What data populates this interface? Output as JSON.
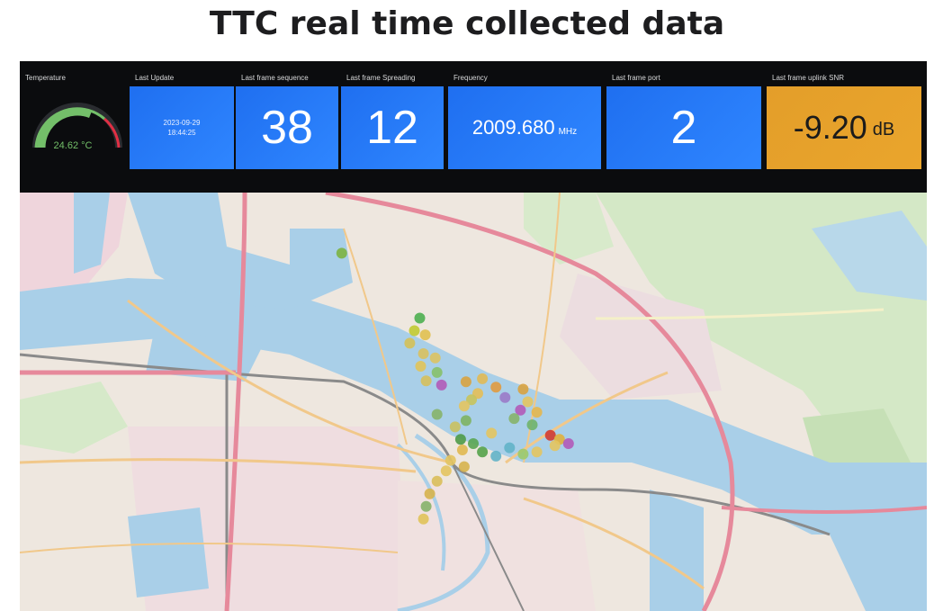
{
  "page": {
    "title": "TTC real time collected data"
  },
  "panels": {
    "temperature": {
      "title": "Temperature",
      "value": "24.62 °C",
      "level": 0.62
    },
    "last_update": {
      "title": "Last Update",
      "date": "2023-09-29",
      "time": "18:44:25"
    },
    "frame_sequence": {
      "title": "Last frame sequence",
      "value": "38"
    },
    "frame_spreading": {
      "title": "Last frame Spreading",
      "value": "12"
    },
    "frequency": {
      "title": "Frequency",
      "value": "2009.680",
      "unit": "MHz"
    },
    "frame_port": {
      "title": "Last frame port",
      "value": "2"
    },
    "uplink_snr": {
      "title": "Last frame uplink SNR",
      "value": "-9.20",
      "unit": "dB"
    }
  },
  "colors": {
    "stat_blue": "#2f80f5",
    "stat_orange": "#e8a22b",
    "gauge_green": "#73bf69",
    "gauge_red": "#e02f44",
    "water": "#a9cfe8",
    "motorway": "#e6899b",
    "rail": "#8a8a8a",
    "park": "#cfe6c4"
  },
  "map": {
    "points": [
      {
        "lat": 0.145,
        "lng": 0.355,
        "color": "#7cb342"
      },
      {
        "lat": 0.3,
        "lng": 0.441,
        "color": "#4caf50"
      },
      {
        "lat": 0.33,
        "lng": 0.435,
        "color": "#c0ca33"
      },
      {
        "lat": 0.34,
        "lng": 0.447,
        "color": "#e0c050"
      },
      {
        "lat": 0.36,
        "lng": 0.43,
        "color": "#d4c058"
      },
      {
        "lat": 0.385,
        "lng": 0.445,
        "color": "#d8c060"
      },
      {
        "lat": 0.395,
        "lng": 0.458,
        "color": "#dcc262"
      },
      {
        "lat": 0.415,
        "lng": 0.442,
        "color": "#e0c35a"
      },
      {
        "lat": 0.43,
        "lng": 0.46,
        "color": "#86c06a"
      },
      {
        "lat": 0.45,
        "lng": 0.448,
        "color": "#d6bf5c"
      },
      {
        "lat": 0.46,
        "lng": 0.465,
        "color": "#b15ab8"
      },
      {
        "lat": 0.452,
        "lng": 0.492,
        "color": "#d8a240"
      },
      {
        "lat": 0.445,
        "lng": 0.51,
        "color": "#e1b955"
      },
      {
        "lat": 0.465,
        "lng": 0.525,
        "color": "#e09a40"
      },
      {
        "lat": 0.48,
        "lng": 0.505,
        "color": "#e4be58"
      },
      {
        "lat": 0.495,
        "lng": 0.498,
        "color": "#c8c35c"
      },
      {
        "lat": 0.51,
        "lng": 0.49,
        "color": "#e3c461"
      },
      {
        "lat": 0.53,
        "lng": 0.46,
        "color": "#86b36a"
      },
      {
        "lat": 0.545,
        "lng": 0.492,
        "color": "#7eb262"
      },
      {
        "lat": 0.56,
        "lng": 0.48,
        "color": "#c9c060"
      },
      {
        "lat": 0.575,
        "lng": 0.52,
        "color": "#e3c461"
      },
      {
        "lat": 0.59,
        "lng": 0.486,
        "color": "#4e9a48"
      },
      {
        "lat": 0.6,
        "lng": 0.5,
        "color": "#5aa552"
      },
      {
        "lat": 0.615,
        "lng": 0.488,
        "color": "#e0b850"
      },
      {
        "lat": 0.62,
        "lng": 0.51,
        "color": "#54a24a"
      },
      {
        "lat": 0.63,
        "lng": 0.525,
        "color": "#62b2c8"
      },
      {
        "lat": 0.64,
        "lng": 0.475,
        "color": "#e3c461"
      },
      {
        "lat": 0.655,
        "lng": 0.49,
        "color": "#d6b24c"
      },
      {
        "lat": 0.665,
        "lng": 0.47,
        "color": "#e3c461"
      },
      {
        "lat": 0.69,
        "lng": 0.46,
        "color": "#d9be5a"
      },
      {
        "lat": 0.72,
        "lng": 0.452,
        "color": "#d6b24c"
      },
      {
        "lat": 0.75,
        "lng": 0.448,
        "color": "#86b36a"
      },
      {
        "lat": 0.78,
        "lng": 0.445,
        "color": "#e0c35a"
      },
      {
        "lat": 0.49,
        "lng": 0.535,
        "color": "#9a7ac8"
      },
      {
        "lat": 0.52,
        "lng": 0.552,
        "color": "#b15ab8"
      },
      {
        "lat": 0.5,
        "lng": 0.56,
        "color": "#e3c461"
      },
      {
        "lat": 0.47,
        "lng": 0.555,
        "color": "#d8a240"
      },
      {
        "lat": 0.525,
        "lng": 0.57,
        "color": "#e4b64c"
      },
      {
        "lat": 0.54,
        "lng": 0.545,
        "color": "#86b36a"
      },
      {
        "lat": 0.555,
        "lng": 0.565,
        "color": "#6fb36a"
      },
      {
        "lat": 0.58,
        "lng": 0.585,
        "color": "#d23a30"
      },
      {
        "lat": 0.59,
        "lng": 0.595,
        "color": "#e0b03c"
      },
      {
        "lat": 0.605,
        "lng": 0.59,
        "color": "#e3c461"
      },
      {
        "lat": 0.6,
        "lng": 0.605,
        "color": "#b15ab8"
      },
      {
        "lat": 0.62,
        "lng": 0.57,
        "color": "#e3c461"
      },
      {
        "lat": 0.625,
        "lng": 0.555,
        "color": "#9bc96b"
      },
      {
        "lat": 0.61,
        "lng": 0.54,
        "color": "#62b2c8"
      }
    ]
  }
}
